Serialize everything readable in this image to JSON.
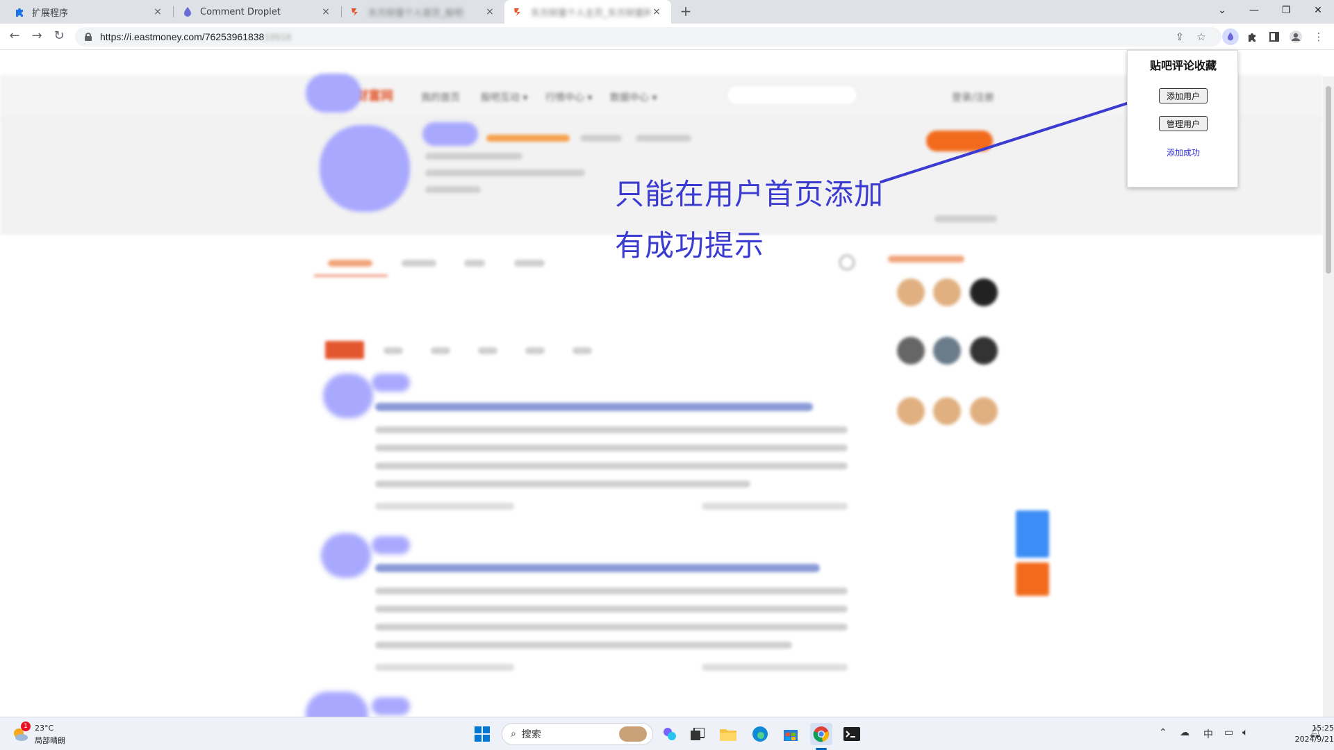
{
  "tabs": [
    {
      "title": "扩展程序",
      "close": "×"
    },
    {
      "title": "Comment Droplet",
      "close": "×"
    },
    {
      "title": "东方财富个人首页_股吧",
      "close": "×"
    },
    {
      "title": "东方财富个人主页_东方财富网",
      "close": "×"
    }
  ],
  "window_controls": {
    "dropdown": "⌄",
    "minimize": "—",
    "restore": "❐",
    "close": "✕"
  },
  "toolbar": {
    "url": "https://i.eastmoney.com/76253961838",
    "url_hidden": "19918"
  },
  "popup": {
    "title": "贴吧评论收藏",
    "add_user_label": "添加用户",
    "manage_user_label": "管理用户",
    "status_message": "添加成功"
  },
  "annotation": {
    "line1": "只能在用户首页添加",
    "line2": "有成功提示"
  },
  "taskbar": {
    "weather_temp": "23°C",
    "weather_desc": "局部晴朗",
    "weather_badge": "1",
    "search_label": "搜索",
    "ime": "中",
    "time": "15:25",
    "date": "2024/9/21"
  },
  "colors": {
    "annotation": "#3b3bd1",
    "popup_message": "#2b2bd6",
    "site_accent": "#e4572e"
  }
}
